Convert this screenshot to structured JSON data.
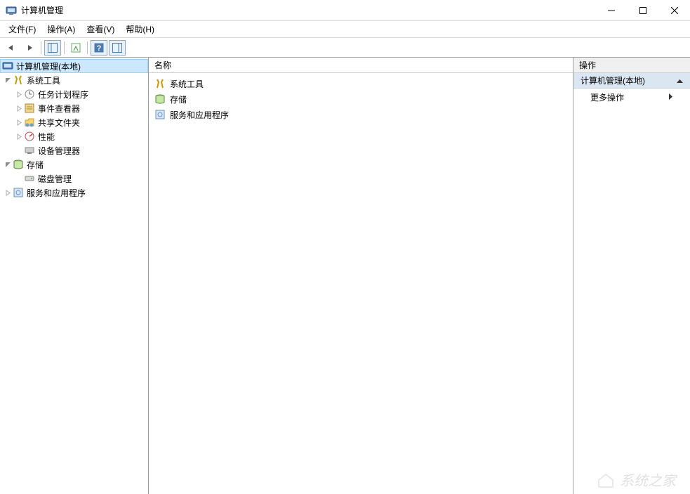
{
  "window": {
    "title": "计算机管理"
  },
  "menubar": {
    "file": "文件(F)",
    "action": "操作(A)",
    "view": "查看(V)",
    "help": "帮助(H)"
  },
  "tree": {
    "root": "计算机管理(本地)",
    "system_tools": "系统工具",
    "task_scheduler": "任务计划程序",
    "event_viewer": "事件查看器",
    "shared_folders": "共享文件夹",
    "performance": "性能",
    "device_manager": "设备管理器",
    "storage": "存储",
    "disk_management": "磁盘管理",
    "services_apps": "服务和应用程序"
  },
  "main": {
    "column_name": "名称",
    "items": {
      "system_tools": "系统工具",
      "storage": "存储",
      "services_apps": "服务和应用程序"
    }
  },
  "actions": {
    "header": "操作",
    "group": "计算机管理(本地)",
    "more": "更多操作"
  },
  "watermark": "系统之家"
}
